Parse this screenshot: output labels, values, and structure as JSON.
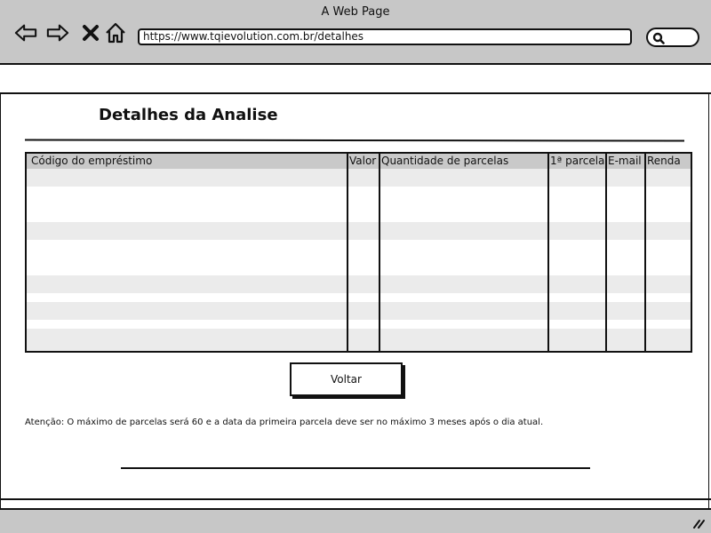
{
  "window": {
    "title": "A Web Page"
  },
  "browser": {
    "url": "https://www.tqievolution.com.br/detalhes",
    "nav_icons": [
      "back-arrow-icon",
      "forward-arrow-icon",
      "close-x-icon",
      "home-icon",
      "search-icon"
    ]
  },
  "page": {
    "title": "Detalhes da Analise",
    "table": {
      "columns": [
        "Código do empréstimo",
        "Valor",
        "Quantidade de parcelas",
        "1ª parcela",
        "E-mail",
        "Renda"
      ],
      "rows": []
    },
    "back_button_label": "Voltar",
    "notice": "Atenção: O máximo de parcelas será 60 e a data da primeira parcela deve ser no máximo 3 meses após o dia atual."
  },
  "colors": {
    "chrome": "#c7c7c7",
    "table_header": "#c9c9c9",
    "row_stripe": "#ebebeb",
    "ink": "#111111"
  }
}
